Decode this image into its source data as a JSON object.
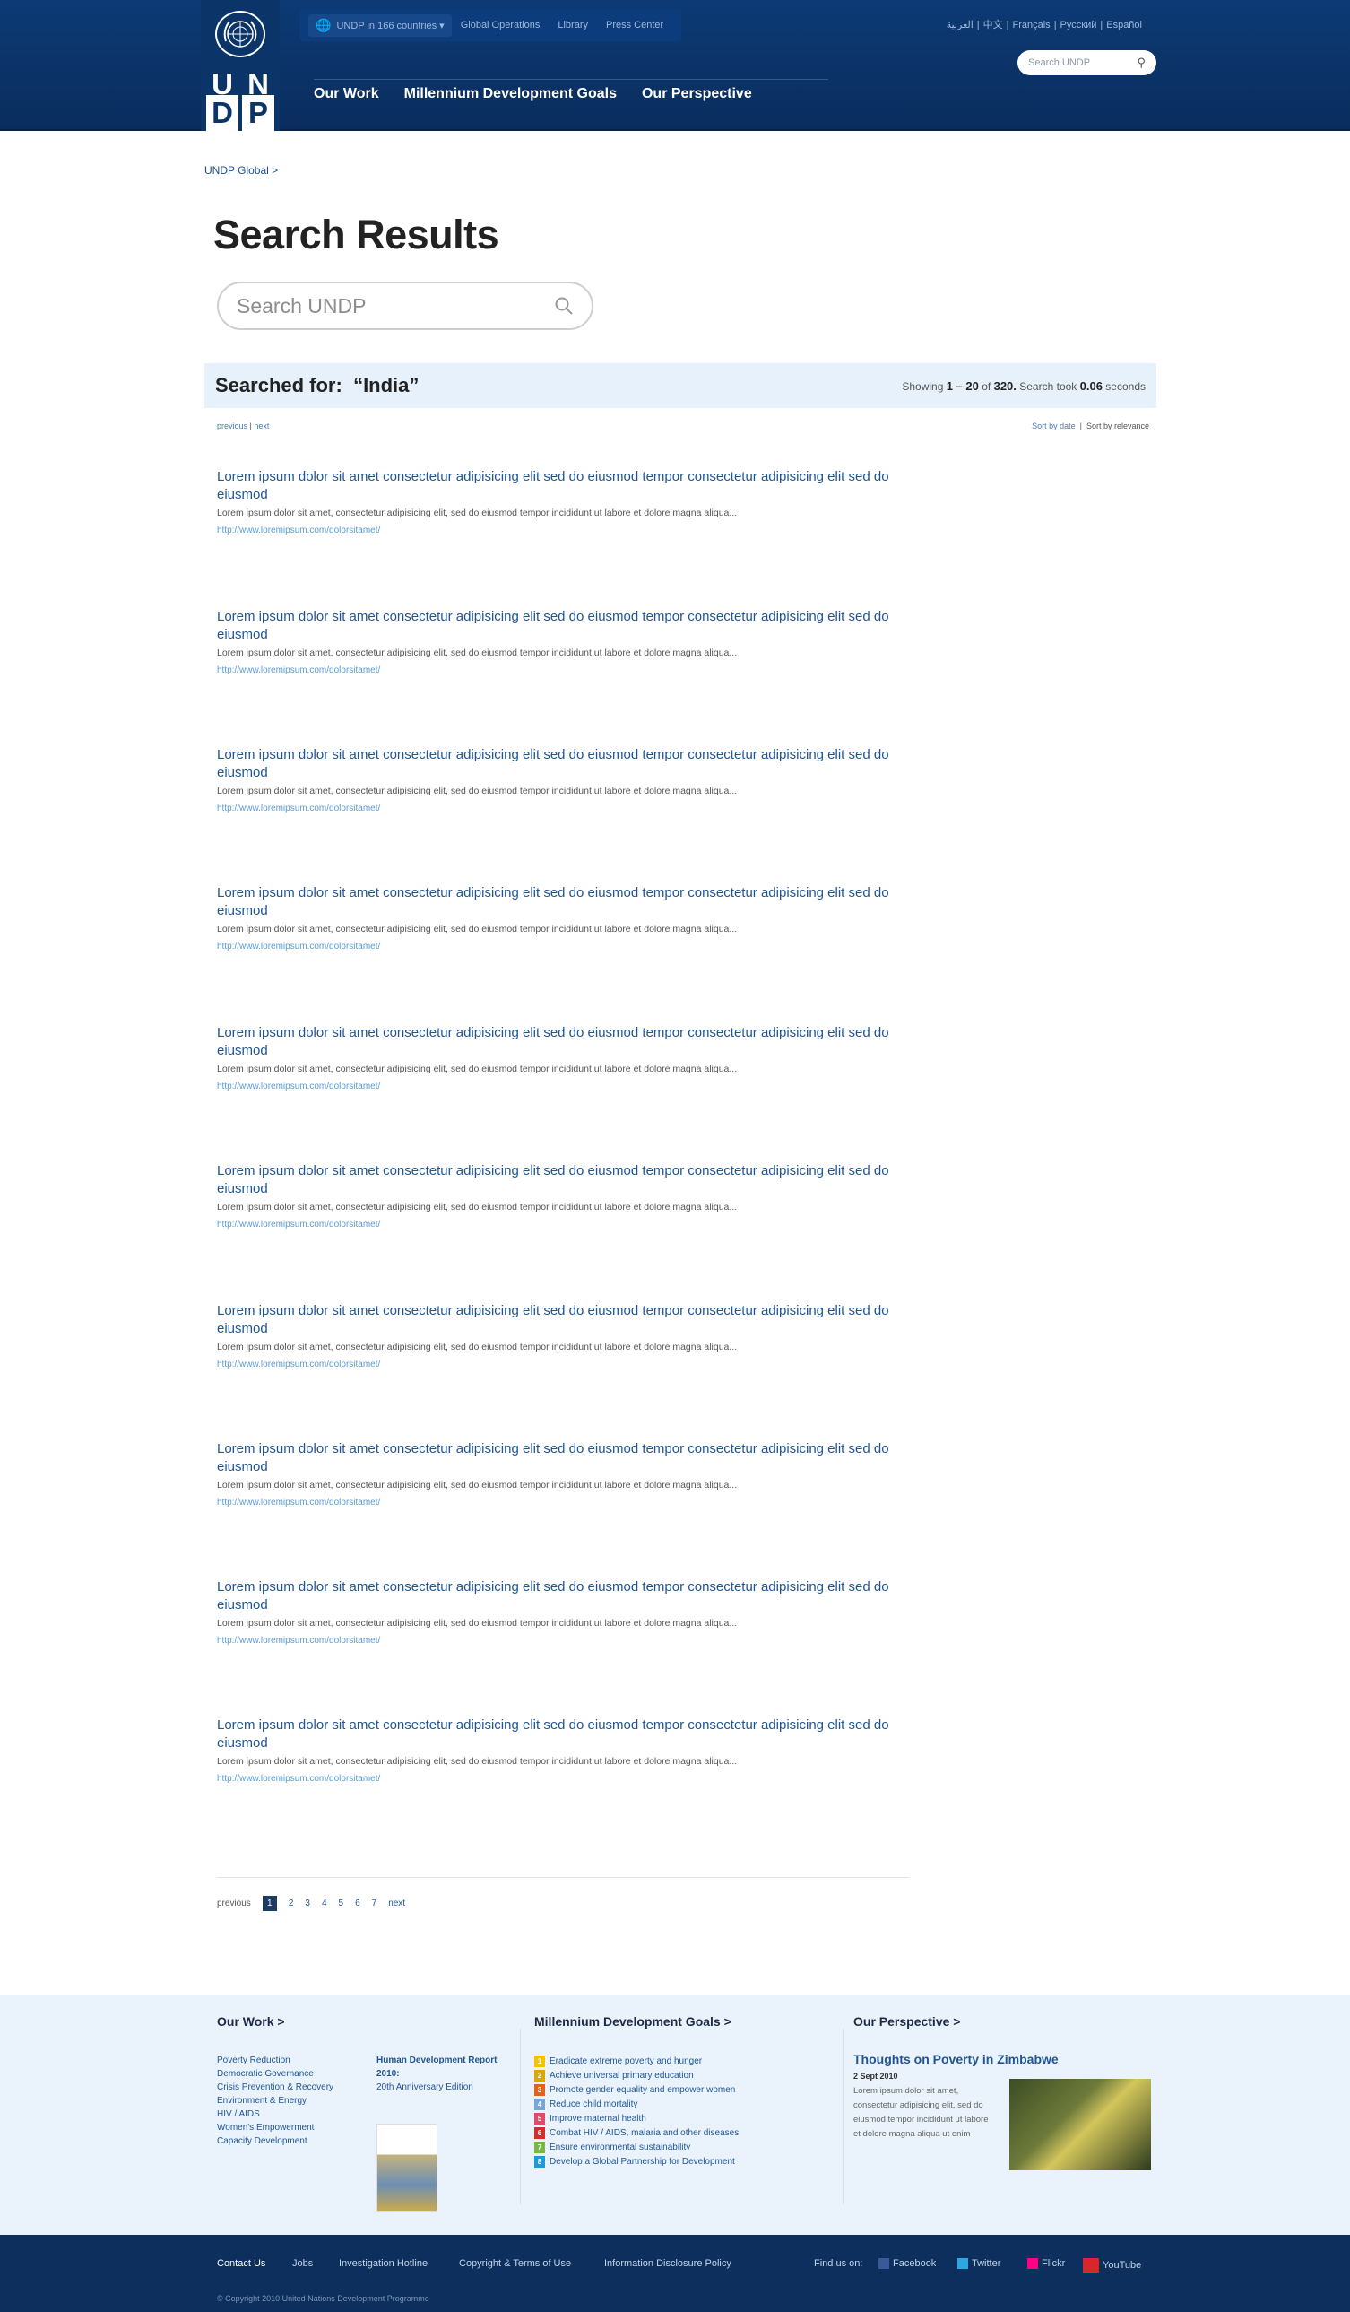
{
  "header": {
    "logo_letters": [
      "U",
      "N",
      "D",
      "P"
    ],
    "top_links": [
      "UNDP in 166 countries ▾",
      "Global Operations",
      "Library",
      "Press Center"
    ],
    "languages": [
      "العربية",
      "中文",
      "Français",
      "Русский",
      "Español"
    ],
    "search_placeholder": "Search UNDP",
    "main_nav": [
      "Our Work",
      "Millennium Development Goals",
      "Our Perspective"
    ]
  },
  "breadcrumb": "UNDP Global  >",
  "page_title": "Search Results",
  "search": {
    "placeholder": "Search UNDP"
  },
  "summary": {
    "searched_for_label": "Searched for:",
    "query": "“India”",
    "showing": "Showing",
    "range": "1 – 20",
    "of": "of",
    "total": "320.",
    "took": "Search took",
    "seconds_value": "0.06",
    "seconds_label": "seconds"
  },
  "paging_top": {
    "previous": "previous",
    "next": "next",
    "sort_date": "Sort by date",
    "sort_relevance": "Sort by relevance"
  },
  "results": [
    {
      "title": "Lorem ipsum dolor sit amet consectetur adipisicing elit sed do eiusmod tempor consectetur adipisicing elit sed do eiusmod",
      "snippet": "Lorem ipsum dolor sit amet, consectetur adipisicing elit, sed do eiusmod tempor incididunt ut labore et dolore magna aliqua...",
      "url": "http://www.loremipsum.com/dolorsitamet/"
    },
    {
      "title": "Lorem ipsum dolor sit amet consectetur adipisicing elit sed do eiusmod tempor consectetur adipisicing elit sed do eiusmod",
      "snippet": "Lorem ipsum dolor sit amet, consectetur adipisicing elit, sed do eiusmod tempor incididunt ut labore et dolore magna aliqua...",
      "url": "http://www.loremipsum.com/dolorsitamet/"
    },
    {
      "title": "Lorem ipsum dolor sit amet consectetur adipisicing elit sed do eiusmod tempor consectetur adipisicing elit sed do eiusmod",
      "snippet": "Lorem ipsum dolor sit amet, consectetur adipisicing elit, sed do eiusmod tempor incididunt ut labore et dolore magna aliqua...",
      "url": "http://www.loremipsum.com/dolorsitamet/"
    },
    {
      "title": "Lorem ipsum dolor sit amet consectetur adipisicing elit sed do eiusmod tempor consectetur adipisicing elit sed do eiusmod",
      "snippet": "Lorem ipsum dolor sit amet, consectetur adipisicing elit, sed do eiusmod tempor incididunt ut labore et dolore magna aliqua...",
      "url": "http://www.loremipsum.com/dolorsitamet/"
    },
    {
      "title": "Lorem ipsum dolor sit amet consectetur adipisicing elit sed do eiusmod tempor consectetur adipisicing elit sed do eiusmod",
      "snippet": "Lorem ipsum dolor sit amet, consectetur adipisicing elit, sed do eiusmod tempor incididunt ut labore et dolore magna aliqua...",
      "url": "http://www.loremipsum.com/dolorsitamet/"
    },
    {
      "title": "Lorem ipsum dolor sit amet consectetur adipisicing elit sed do eiusmod tempor consectetur adipisicing elit sed do eiusmod",
      "snippet": "Lorem ipsum dolor sit amet, consectetur adipisicing elit, sed do eiusmod tempor incididunt ut labore et dolore magna aliqua...",
      "url": "http://www.loremipsum.com/dolorsitamet/"
    },
    {
      "title": "Lorem ipsum dolor sit amet consectetur adipisicing elit sed do eiusmod tempor consectetur adipisicing elit sed do eiusmod",
      "snippet": "Lorem ipsum dolor sit amet, consectetur adipisicing elit, sed do eiusmod tempor incididunt ut labore et dolore magna aliqua...",
      "url": "http://www.loremipsum.com/dolorsitamet/"
    },
    {
      "title": "Lorem ipsum dolor sit amet consectetur adipisicing elit sed do eiusmod tempor consectetur adipisicing elit sed do eiusmod",
      "snippet": "Lorem ipsum dolor sit amet, consectetur adipisicing elit, sed do eiusmod tempor incididunt ut labore et dolore magna aliqua...",
      "url": "http://www.loremipsum.com/dolorsitamet/"
    },
    {
      "title": "Lorem ipsum dolor sit amet consectetur adipisicing elit sed do eiusmod tempor consectetur adipisicing elit sed do eiusmod",
      "snippet": "Lorem ipsum dolor sit amet, consectetur adipisicing elit, sed do eiusmod tempor incididunt ut labore et dolore magna aliqua...",
      "url": "http://www.loremipsum.com/dolorsitamet/"
    },
    {
      "title": "Lorem ipsum dolor sit amet consectetur adipisicing elit sed do eiusmod tempor consectetur adipisicing elit sed do eiusmod",
      "snippet": "Lorem ipsum dolor sit amet, consectetur adipisicing elit, sed do eiusmod tempor incididunt ut labore et dolore magna aliqua...",
      "url": "http://www.loremipsum.com/dolorsitamet/"
    }
  ],
  "pager": {
    "previous": "previous",
    "current": "1",
    "pages": [
      "2",
      "3",
      "4",
      "5",
      "6",
      "7"
    ],
    "next": "next"
  },
  "footer": {
    "our_work": {
      "heading": "Our Work  >",
      "links": [
        "Poverty Reduction",
        "Democratic Governance",
        "Crisis Prevention & Recovery",
        "Environment & Energy",
        "HIV / AIDS",
        "Women's Empowerment",
        "Capacity Development"
      ],
      "report_title": "Human Development Report 2010:",
      "report_sub": "20th Anniversary Edition"
    },
    "mdg": {
      "heading": "Millennium Development Goals  >",
      "goals": [
        {
          "num": "1",
          "text": "Eradicate extreme poverty and hunger",
          "color": "#f2c400"
        },
        {
          "num": "2",
          "text": "Achieve universal primary education",
          "color": "#d9a900"
        },
        {
          "num": "3",
          "text": "Promote gender equality and empower women",
          "color": "#e0621d"
        },
        {
          "num": "4",
          "text": "Reduce child mortality",
          "color": "#7aa6d6"
        },
        {
          "num": "5",
          "text": "Improve maternal health",
          "color": "#e04b6b"
        },
        {
          "num": "6",
          "text": "Combat HIV / AIDS, malaria and other diseases",
          "color": "#d42d2d"
        },
        {
          "num": "7",
          "text": "Ensure environmental sustainability",
          "color": "#7ab648"
        },
        {
          "num": "8",
          "text": "Develop a Global Partnership for Development",
          "color": "#1f9ad6"
        }
      ]
    },
    "perspective": {
      "heading": "Our Perspective  >",
      "article_title": "Thoughts on Poverty in Zimbabwe",
      "date": "2 Sept 2010",
      "text": "Lorem ipsum dolor sit amet, consectetur adipisicing elit, sed do eiusmod tempor incididunt ut labore et dolore magna aliqua ut enim"
    }
  },
  "bottom_bar": {
    "links": [
      "Contact Us",
      "Jobs",
      "Investigation Hotline",
      "Copyright & Terms of Use",
      "Information Disclosure Policy"
    ],
    "find_us": "Find us on:",
    "social": [
      {
        "label": "Facebook",
        "color": "#3b5998"
      },
      {
        "label": "Twitter",
        "color": "#2aa9e0"
      },
      {
        "label": "Flickr",
        "color": "#ff0084"
      },
      {
        "label": "YouTube",
        "color": "#d8262b"
      }
    ],
    "copyright": "© Copyright 2010 United Nations Development Programme"
  }
}
